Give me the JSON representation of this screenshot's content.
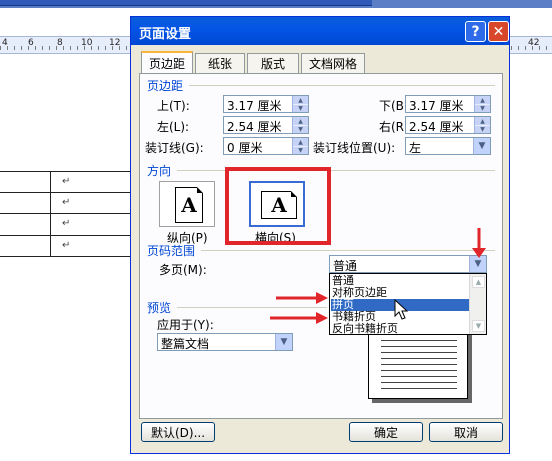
{
  "ruler": {
    "numbers": [
      "4",
      "6",
      "8",
      "10",
      "12"
    ],
    "right_number": "42"
  },
  "doc": {
    "cell_mark": "↵"
  },
  "dialog": {
    "title": "页面设置",
    "help_glyph": "?",
    "close_glyph": "✕",
    "tabs": [
      {
        "label": "页边距",
        "active": true
      },
      {
        "label": "纸张",
        "active": false
      },
      {
        "label": "版式",
        "active": false
      },
      {
        "label": "文档网格",
        "active": false
      }
    ],
    "margins": {
      "section_title": "页边距",
      "top_label": "上(T):",
      "top_value": "3.17 厘米",
      "bottom_label": "下(B):",
      "bottom_value": "3.17 厘米",
      "left_label": "左(L):",
      "left_value": "2.54 厘米",
      "right_label": "右(R):",
      "right_value": "2.54 厘米",
      "gutter_label": "装订线(G):",
      "gutter_value": "0 厘米",
      "gutter_pos_label": "装订线位置(U):",
      "gutter_pos_value": "左"
    },
    "orientation": {
      "section_title": "方向",
      "portrait_label": "纵向(P)",
      "landscape_label": "横向(S)",
      "glyph": "A"
    },
    "pages": {
      "section_title": "页码范围",
      "multiple_label": "多页(M):",
      "selected": "普通",
      "options": [
        "普通",
        "对称页边距",
        "拼页",
        "书籍折页",
        "反向书籍折页"
      ],
      "highlighted": "拼页"
    },
    "preview": {
      "section_title": "预览",
      "apply_label": "应用于(Y):",
      "apply_value": "整篇文档"
    },
    "buttons": {
      "default": "默认(D)...",
      "ok": "确定",
      "cancel": "取消"
    }
  },
  "colors": {
    "annotation_red": "#e0262b",
    "title_blue": "#0554e6",
    "section_blue": "#0046d5",
    "highlight": "#316ac5"
  }
}
